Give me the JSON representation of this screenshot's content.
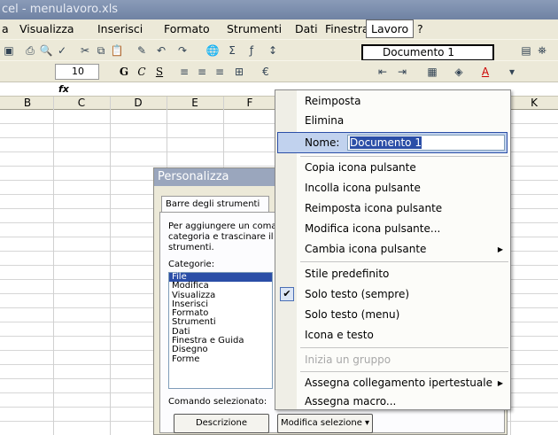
{
  "window": {
    "title": "cel - menulavoro.xls"
  },
  "menubar": {
    "items": [
      "a",
      "Visualizza",
      "Inserisci",
      "Formato",
      "Strumenti",
      "Dati",
      "Finestra",
      "Lavoro",
      "?"
    ]
  },
  "toolbar": {
    "font_size": "10",
    "bold": "G",
    "italic": "C",
    "underline": "S"
  },
  "formula": {
    "fx": "fx"
  },
  "columns": [
    "B",
    "C",
    "D",
    "E",
    "F",
    "K"
  ],
  "tooltip_button": {
    "label": "Documento 1"
  },
  "dialog": {
    "title": "Personalizza",
    "tab": "Barre degli strumenti",
    "description": "Per aggiungere un coma categoria e trascinare il c strumenti.",
    "categories_label": "Categorie:",
    "categories": [
      "File",
      "Modifica",
      "Visualizza",
      "Inserisci",
      "Formato",
      "Strumenti",
      "Dati",
      "Finestra e Guida",
      "Disegno",
      "Forme"
    ],
    "selected_category": "File",
    "selected_command_label": "Comando selezionato:",
    "describe_button": "Descrizione",
    "modify_button": "Modifica selezione ▾"
  },
  "context_menu": {
    "items": [
      {
        "label": "Reimposta",
        "enabled": true
      },
      {
        "label": "Elimina",
        "enabled": true
      },
      {
        "label": "Copia icona pulsante",
        "enabled": true
      },
      {
        "label": "Incolla icona pulsante",
        "enabled": true
      },
      {
        "label": "Reimposta icona pulsante",
        "enabled": true
      },
      {
        "label": "Modifica icona pulsante...",
        "enabled": true
      },
      {
        "label": "Cambia icona pulsante",
        "enabled": true,
        "submenu": true
      },
      {
        "label": "Stile predefinito",
        "enabled": true
      },
      {
        "label": "Solo testo (sempre)",
        "enabled": true,
        "checked": true
      },
      {
        "label": "Solo testo (menu)",
        "enabled": true
      },
      {
        "label": "Icona e testo",
        "enabled": true
      },
      {
        "label": "Inizia un gruppo",
        "enabled": false
      },
      {
        "label": "Assegna collegamento ipertestuale",
        "enabled": true,
        "submenu": true
      },
      {
        "label": "Assegna macro...",
        "enabled": true
      }
    ],
    "name_label": "Nome:",
    "name_value": "Documento 1"
  }
}
